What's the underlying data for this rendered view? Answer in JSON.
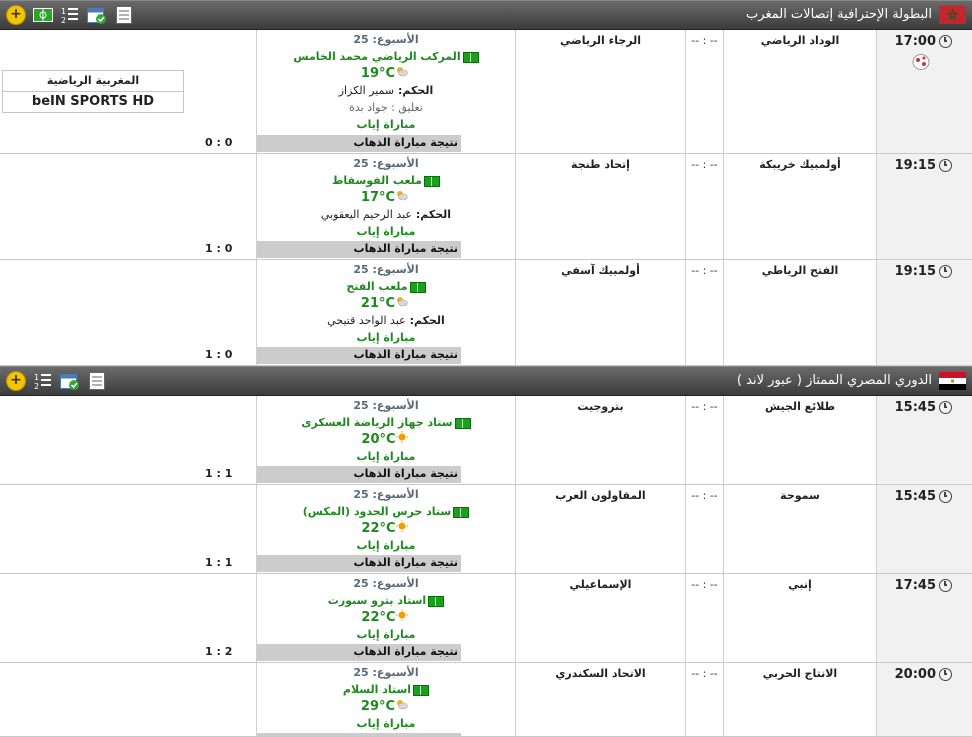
{
  "leagues": [
    {
      "title": "البطولة الإحترافية إتصالات المغرب",
      "flag": "morocco-flag",
      "tools": [
        "plus-icon",
        "pitch-icon",
        "standings-icon",
        "calendar-icon",
        "list-icon"
      ],
      "matches": [
        {
          "time": "17:00",
          "home": "الوداد الرياضي",
          "score": "-- : --",
          "away": "الرجاء الرياضي",
          "week_label": "الأسبوع:",
          "week": "25",
          "stadium": "المركب الرياضي محمد الخامس",
          "temp": "19°C",
          "weather": "cloudy-sun",
          "ref_label": "الحكم:",
          "ref": "سمير الكزاز",
          "comm_label": "تعليق :",
          "comm": "جواد بدة",
          "live": "مباراة إياب",
          "result_label": "نتيجة مباراة الذهاب",
          "result": "0 : 0",
          "tv": [
            "المغربية الرياضية",
            "beIN SPORTS HD"
          ],
          "has_ball": true
        },
        {
          "time": "19:15",
          "home": "أولمبيك خريبكة",
          "score": "-- : --",
          "away": "إتحاد طنجة",
          "week_label": "الأسبوع:",
          "week": "25",
          "stadium": "ملعب الفوسفاط",
          "temp": "17°C",
          "weather": "cloudy-sun",
          "ref_label": "الحكم:",
          "ref": "عبد الرحيم اليعقوبي",
          "live": "مباراة إياب",
          "result_label": "نتيجة مباراة الذهاب",
          "result": "1 : 0"
        },
        {
          "time": "19:15",
          "home": "الفتح الرياطي",
          "score": "-- : --",
          "away": "أولمبيك آسفي",
          "week_label": "الأسبوع:",
          "week": "25",
          "stadium": "ملعب الفتح",
          "temp": "21°C",
          "weather": "cloudy-sun",
          "ref_label": "الحكم:",
          "ref": "عبد الواحد قتيحي",
          "live": "مباراة إياب",
          "result_label": "نتيجة مباراة الذهاب",
          "result": "1 : 0"
        }
      ]
    },
    {
      "title": "الدوري المصري الممتاز ( عبور لاند )",
      "flag": "egypt-flag",
      "tools": [
        "plus-icon",
        "standings-icon",
        "calendar-icon",
        "list-icon"
      ],
      "matches": [
        {
          "time": "15:45",
          "home": "طلائع الجيش",
          "score": "-- : --",
          "away": "بتروجيت",
          "week_label": "الأسبوع:",
          "week": "25",
          "stadium": "ستاد جهاز الرياضة العسكرى",
          "temp": "20°C",
          "weather": "sun",
          "live": "مباراة إياب",
          "result_label": "نتيجة مباراة الذهاب",
          "result": "1 : 1"
        },
        {
          "time": "15:45",
          "home": "سموحة",
          "score": "-- : --",
          "away": "المقاولون العرب",
          "week_label": "الأسبوع:",
          "week": "25",
          "stadium": "ستاد حرس الحدود (المكس)",
          "temp": "22°C",
          "weather": "sun",
          "live": "مباراة إياب",
          "result_label": "نتيجة مباراة الذهاب",
          "result": "1 : 1"
        },
        {
          "time": "17:45",
          "home": "إنبي",
          "score": "-- : --",
          "away": "الإسماعيلي",
          "week_label": "الأسبوع:",
          "week": "25",
          "stadium": "استاد بترو سبورت",
          "temp": "22°C",
          "weather": "sun",
          "live": "مباراة إياب",
          "result_label": "نتيجة مباراة الذهاب",
          "result": "1 : 2"
        },
        {
          "time": "20:00",
          "home": "الانتاج الحربي",
          "score": "-- : --",
          "away": "الاتحاد السكندري",
          "week_label": "الأسبوع:",
          "week": "25",
          "stadium": "استاد السلام",
          "temp": "29°C",
          "weather": "cloudy-sun",
          "live": "مباراة إياب",
          "result_label": "",
          "result": ""
        }
      ]
    }
  ],
  "colors": {
    "stadium": "#1e8a1e",
    "week": "#5a6a7a",
    "header": "#4a4a4a",
    "result_bg": "#cccccc"
  }
}
